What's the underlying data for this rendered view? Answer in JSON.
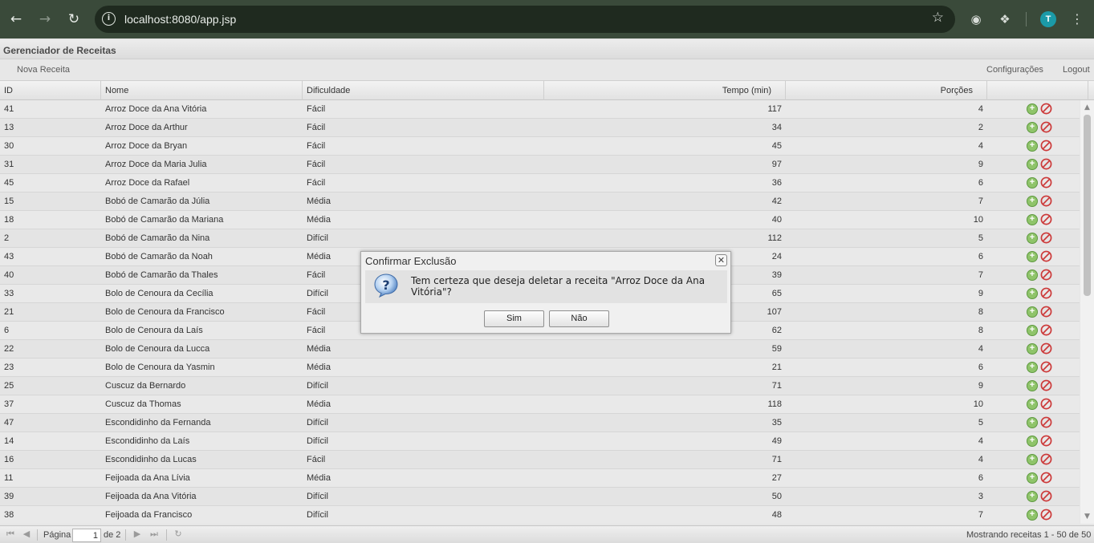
{
  "browser": {
    "url": "localhost:8080/app.jsp",
    "avatar_letter": "T",
    "icons": [
      "back-icon",
      "forward-icon",
      "reload-icon",
      "info-icon",
      "star-icon",
      "camera-icon",
      "extensions-icon",
      "menu-icon"
    ]
  },
  "app": {
    "title": "Gerenciador de Receitas",
    "toolbar": {
      "new_recipe": "Nova Receita",
      "settings": "Configurações",
      "logout": "Logout"
    }
  },
  "grid": {
    "columns": [
      "ID",
      "Nome",
      "Dificuldade",
      "Tempo (min)",
      "Porções"
    ],
    "rows": [
      [
        "41",
        "Arroz Doce da Ana Vitória",
        "Fácil",
        "117",
        "4"
      ],
      [
        "13",
        "Arroz Doce da Arthur",
        "Fácil",
        "34",
        "2"
      ],
      [
        "30",
        "Arroz Doce da Bryan",
        "Fácil",
        "45",
        "4"
      ],
      [
        "31",
        "Arroz Doce da Maria Julia",
        "Fácil",
        "97",
        "9"
      ],
      [
        "45",
        "Arroz Doce da Rafael",
        "Fácil",
        "36",
        "6"
      ],
      [
        "15",
        "Bobó de Camarão da Júlia",
        "Média",
        "42",
        "7"
      ],
      [
        "18",
        "Bobó de Camarão da Mariana",
        "Média",
        "40",
        "10"
      ],
      [
        "2",
        "Bobó de Camarão da Nina",
        "Difícil",
        "112",
        "5"
      ],
      [
        "43",
        "Bobó de Camarão da Noah",
        "Média",
        "24",
        "6"
      ],
      [
        "40",
        "Bobó de Camarão da Thales",
        "Fácil",
        "39",
        "7"
      ],
      [
        "33",
        "Bolo de Cenoura da Cecília",
        "Difícil",
        "65",
        "9"
      ],
      [
        "21",
        "Bolo de Cenoura da Francisco",
        "Fácil",
        "107",
        "8"
      ],
      [
        "6",
        "Bolo de Cenoura da Laís",
        "Fácil",
        "62",
        "8"
      ],
      [
        "22",
        "Bolo de Cenoura da Lucca",
        "Média",
        "59",
        "4"
      ],
      [
        "23",
        "Bolo de Cenoura da Yasmin",
        "Média",
        "21",
        "6"
      ],
      [
        "25",
        "Cuscuz da Bernardo",
        "Difícil",
        "71",
        "9"
      ],
      [
        "37",
        "Cuscuz da Thomas",
        "Média",
        "118",
        "10"
      ],
      [
        "47",
        "Escondidinho da Fernanda",
        "Difícil",
        "35",
        "5"
      ],
      [
        "14",
        "Escondidinho da Laís",
        "Difícil",
        "49",
        "4"
      ],
      [
        "16",
        "Escondidinho da Lucas",
        "Fácil",
        "71",
        "4"
      ],
      [
        "11",
        "Feijoada da Ana Lívia",
        "Média",
        "27",
        "6"
      ],
      [
        "39",
        "Feijoada da Ana Vitória",
        "Difícil",
        "50",
        "3"
      ],
      [
        "38",
        "Feijoada da Francisco",
        "Difícil",
        "48",
        "7"
      ]
    ],
    "row_actions": {
      "add_icon": "add-icon",
      "delete_icon": "delete-icon"
    }
  },
  "pager": {
    "page_label": "Página",
    "page_value": "1",
    "of_label": "de 2",
    "status": "Mostrando receitas 1 - 50 de 50"
  },
  "dialog": {
    "title": "Confirmar Exclusão",
    "message": "Tem certeza que deseja deletar a receita \"Arroz Doce da Ana Vitória\"?",
    "yes": "Sim",
    "no": "Não",
    "icon": "question-icon"
  }
}
